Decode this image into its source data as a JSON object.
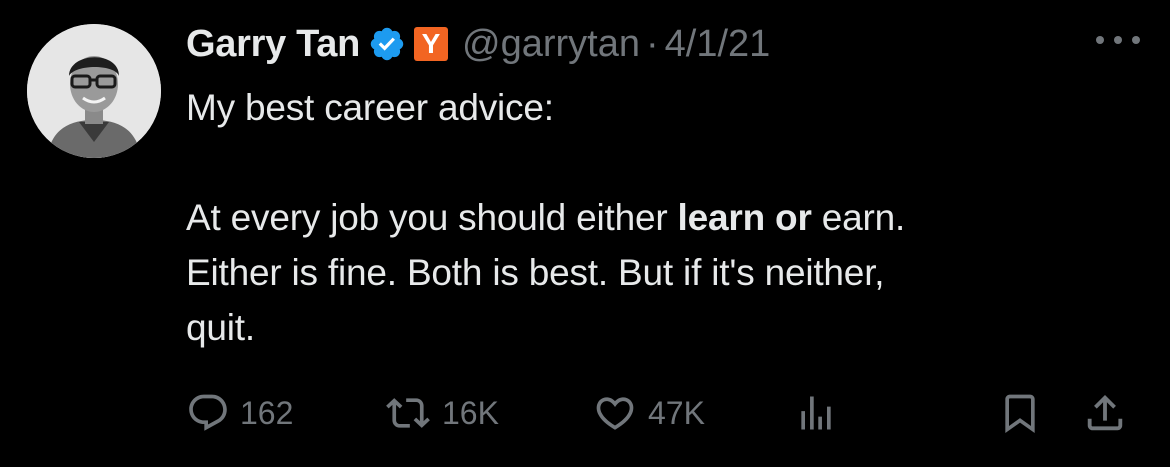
{
  "author": {
    "name": "Garry Tan",
    "handle": "@garrytan",
    "separator": "·",
    "date": "4/1/21",
    "badge_text": "Y",
    "badge_color": "#f26522",
    "verified_color": "#1d9bf0"
  },
  "tweet": {
    "line1": "My best career advice:",
    "line2_pre": "At every job you should either ",
    "line2_bold": "learn or",
    "line2_post": " earn.",
    "line3": "Either is fine. Both is best. But if it's neither,",
    "line4": "quit."
  },
  "metrics": {
    "replies": "162",
    "retweets": "16K",
    "likes": "47K"
  },
  "icons": {
    "reply": "reply-icon",
    "retweet": "retweet-icon",
    "like": "heart-icon",
    "views": "analytics-icon",
    "bookmark": "bookmark-icon",
    "share": "share-icon",
    "more": "more-icon"
  },
  "colors": {
    "background": "#000000",
    "text": "#e7e9ea",
    "secondary": "#71767b"
  }
}
